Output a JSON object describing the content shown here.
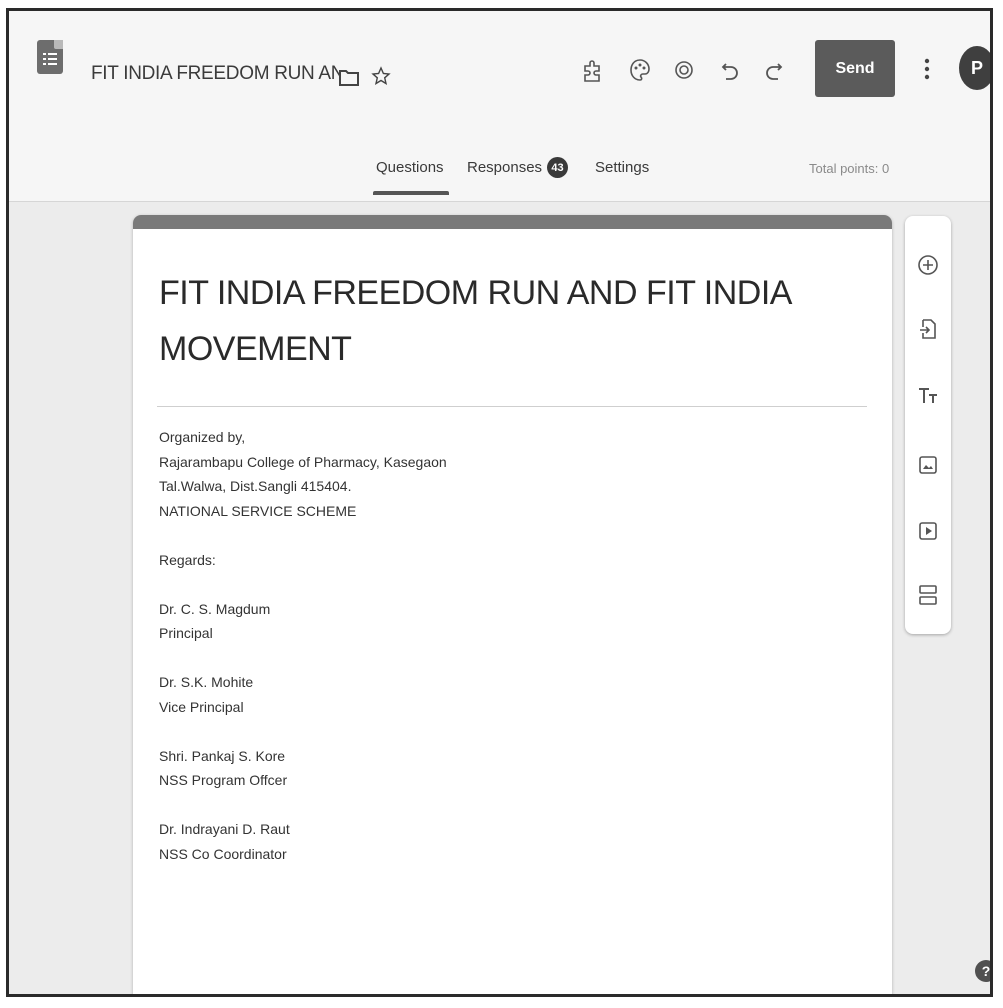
{
  "header": {
    "doc_title": "FIT INDIA FREEDOM RUN AND FIT INDIA MOVEMENT",
    "send_label": "Send",
    "avatar_initial": "P"
  },
  "tabs": {
    "questions": "Questions",
    "responses": "Responses",
    "responses_count": "43",
    "settings": "Settings",
    "total_points": "Total points: 0"
  },
  "form": {
    "title": "FIT INDIA FREEDOM RUN AND FIT INDIA MOVEMENT",
    "description_lines": [
      "Organized by,",
      "Rajarambapu College of Pharmacy, Kasegaon",
      "Tal.Walwa, Dist.Sangli 415404.",
      "NATIONAL SERVICE SCHEME",
      "",
      "Regards:",
      "",
      "Dr. C. S. Magdum",
      "Principal",
      "",
      "Dr. S.K. Mohite",
      "Vice Principal",
      "",
      "Shri. Pankaj S. Kore",
      "NSS Program Offcer",
      "",
      "Dr. Indrayani D. Raut",
      "NSS Co Coordinator"
    ]
  },
  "help_label": "?",
  "colors": {
    "accent": "#7a7a7a",
    "send_button": "#5b5b5b",
    "page_background": "#ececec"
  }
}
